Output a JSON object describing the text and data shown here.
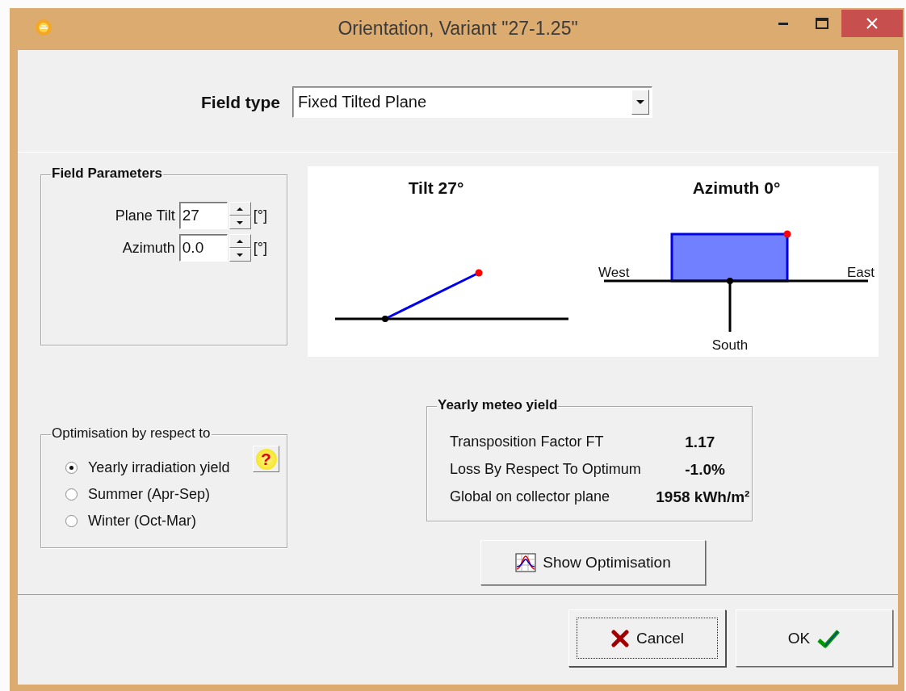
{
  "window": {
    "title": "Orientation, Variant \"27-1.25\""
  },
  "field_type": {
    "label": "Field type",
    "value": "Fixed Tilted Plane"
  },
  "field_parameters": {
    "title": "Field Parameters",
    "fields": [
      {
        "label": "Plane Tilt",
        "value": "27",
        "unit": "[°]"
      },
      {
        "label": "Azimuth",
        "value": "0.0",
        "unit": "[°]"
      }
    ]
  },
  "diagram": {
    "tilt_title": "Tilt 27°",
    "azimuth_title": "Azimuth 0°",
    "west": "West",
    "east": "East",
    "south": "South"
  },
  "optimisation": {
    "title": "Optimisation by respect to",
    "help": "?",
    "options": [
      {
        "label": "Yearly irradiation yield",
        "selected": true
      },
      {
        "label": "Summer (Apr-Sep)",
        "selected": false
      },
      {
        "label": "Winter (Oct-Mar)",
        "selected": false
      }
    ]
  },
  "yearly_yield": {
    "title": "Yearly meteo yield",
    "rows": [
      {
        "label": "Transposition Factor FT",
        "value": "1.17"
      },
      {
        "label": "Loss By Respect To Optimum",
        "value": "-1.0%"
      },
      {
        "label": "Global on collector plane",
        "value": "1958 kWh/m²"
      }
    ]
  },
  "show_optimisation": {
    "label": "Show Optimisation"
  },
  "buttons": [
    {
      "kind": "cancel",
      "label": "Cancel",
      "focused": true
    },
    {
      "kind": "ok",
      "label": "OK",
      "focused": false
    }
  ]
}
